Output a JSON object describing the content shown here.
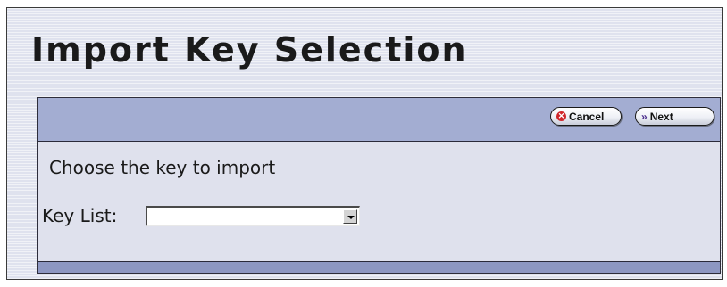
{
  "page": {
    "title": "Import Key Selection"
  },
  "toolbar": {
    "cancel_label": "Cancel",
    "next_label": "Next",
    "cancel_icon": "cancel-icon",
    "next_icon": "double-chevron-right-icon"
  },
  "form": {
    "instruction": "Choose the key to import",
    "key_list_label": "Key List:",
    "key_list_selected": ""
  },
  "colors": {
    "toolbar_bg": "#a3add2",
    "panel_bg": "#dfe1ed",
    "footer_bg": "#8d97c2",
    "cancel_icon": "#d0262b",
    "next_icon": "#4b2d8c"
  }
}
